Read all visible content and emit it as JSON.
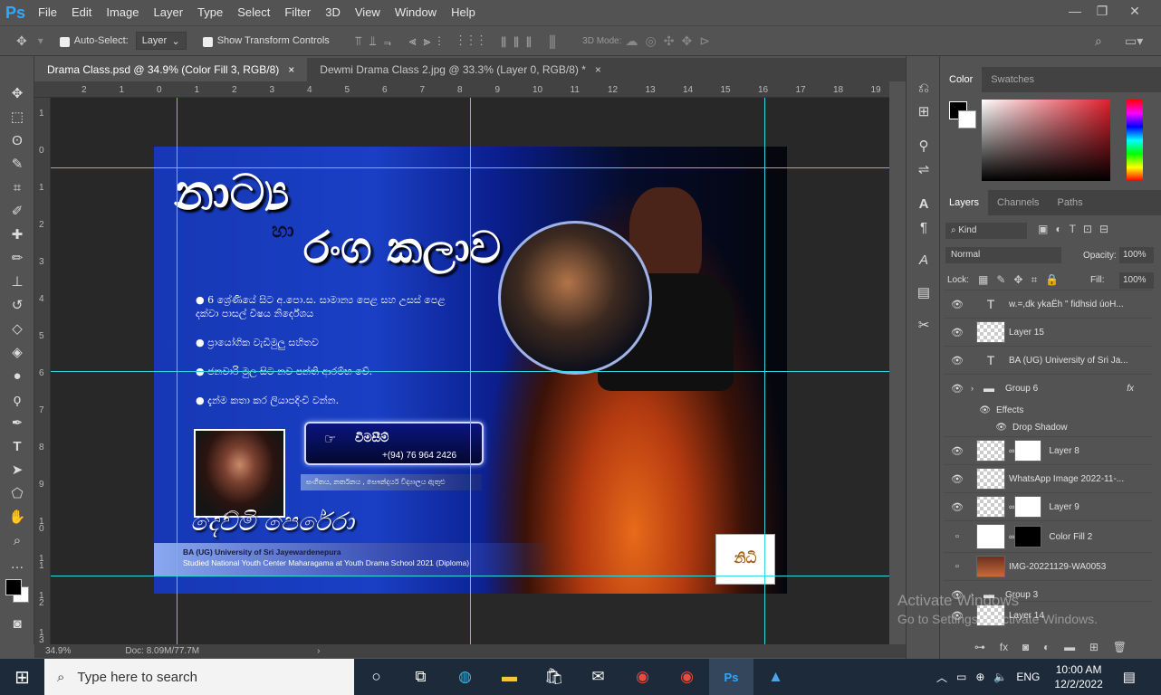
{
  "app": {
    "logo": "Ps",
    "menus": [
      "File",
      "Edit",
      "Image",
      "Layer",
      "Type",
      "Select",
      "Filter",
      "3D",
      "View",
      "Window",
      "Help"
    ]
  },
  "options": {
    "auto_select_label": "Auto-Select:",
    "auto_select_value": "Layer",
    "show_transform_label": "Show Transform Controls",
    "mode_3d": "3D Mode:"
  },
  "tabs": [
    {
      "label": "Drama Class.psd @ 34.9% (Color Fill 3, RGB/8)",
      "close": "×",
      "active": true
    },
    {
      "label": "Dewmi Drama Class 2.jpg @ 33.3% (Layer 0, RGB/8) *",
      "close": "×",
      "active": false
    }
  ],
  "ruler_h": [
    "2",
    "1",
    "0",
    "1",
    "2",
    "3",
    "4",
    "5",
    "6",
    "7",
    "8",
    "9",
    "10",
    "11",
    "12",
    "13",
    "14",
    "15",
    "16",
    "17",
    "18",
    "19"
  ],
  "ruler_v": [
    "1",
    "0",
    "1",
    "2",
    "3",
    "4",
    "5",
    "6",
    "7",
    "8",
    "9",
    "1 0",
    "1 1",
    "1 2",
    "1 3"
  ],
  "poster": {
    "title1": "නාට්‍ය",
    "title_ha": "හා",
    "title2": "රංග කලාව",
    "bullets": [
      "6 ශ්‍රේණියේ සිට අ.පො.ස. සාමාන්‍ය පෙළ සහ උසස් පෙළ\nදක්වා පාසල් විෂය නිර්දේශය",
      "ප්‍රායෝගික වැඩිමුලු සහිතව",
      "ජනවාරි මුල සිට නව පන්ති ආරම්භ වේ.",
      "දැන්ම කතා කර ලියාපදිංචි වන්න."
    ],
    "contact_label": "විමසීම්",
    "phone": "+(94) 76 964 2426",
    "strip_text": "සංගීතය, නර්තනය , සෞන්දර්ය විද්‍යාලය ඇතුළු",
    "teacher_name": "දෙව්මි පෙරේරා",
    "footer1": "BA (UG) University of Sri Jayewardenepura",
    "footer2": "Studied National Youth Center Maharagama at Youth Drama School 2021 (Diploma)",
    "logo_text": "නිධි"
  },
  "status": {
    "zoom": "34.9%",
    "doc": "Doc: 8.09M/77.7M"
  },
  "panels": {
    "color_tabs": [
      "Color",
      "Swatches"
    ],
    "layer_tabs": [
      "Layers",
      "Channels",
      "Paths"
    ],
    "kind": "Kind",
    "blend": "Normal",
    "opacity_label": "Opacity:",
    "opacity": "100%",
    "lock_label": "Lock:",
    "fill_label": "Fill:",
    "fill": "100%",
    "layers": [
      {
        "name": "w.=,dk ykaËh \" fidhsid úoH...",
        "kind": "text",
        "visible": true
      },
      {
        "name": "Layer 15",
        "kind": "pixel",
        "visible": true
      },
      {
        "name": "BA (UG) University of Sri Ja...",
        "kind": "text",
        "visible": true
      },
      {
        "name": "Group 6",
        "kind": "group",
        "visible": true
      },
      {
        "name": "Effects",
        "kind": "effects",
        "visible": true
      },
      {
        "name": "Drop Shadow",
        "kind": "effect",
        "visible": true
      },
      {
        "name": "Layer 8",
        "kind": "masked",
        "visible": true
      },
      {
        "name": "WhatsApp Image 2022-11-...",
        "kind": "smart",
        "visible": true
      },
      {
        "name": "Layer 9",
        "kind": "masked",
        "visible": true
      },
      {
        "name": "Color Fill 2",
        "kind": "fill",
        "visible": false
      },
      {
        "name": "IMG-20221129-WA0053",
        "kind": "photo",
        "visible": false
      },
      {
        "name": "Group 3",
        "kind": "group",
        "visible": true
      },
      {
        "name": "Layer 14",
        "kind": "pixel",
        "visible": true
      }
    ],
    "fx": "fx"
  },
  "watermark": {
    "line1": "Activate Windows",
    "line2": "Go to Settings to activate Windows."
  },
  "taskbar": {
    "search": "Type here to search",
    "time": "10:00 AM",
    "date": "12/2/2022",
    "lang": "ENG"
  },
  "colors": {
    "accent": "#31a8ff",
    "guide": "#31d6e0",
    "poster_blue": "#1a3fc4"
  }
}
